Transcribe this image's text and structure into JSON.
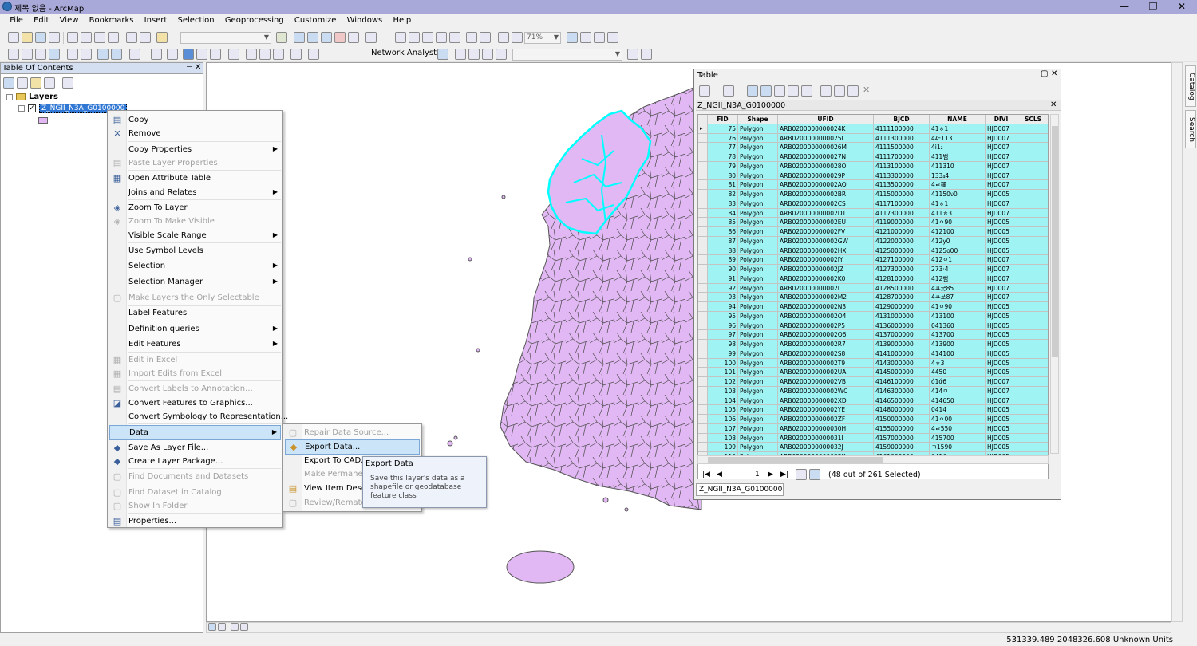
{
  "window": {
    "title": "제목 없음 - ArcMap",
    "minimize": "—",
    "maximize": "❐",
    "close": "✕"
  },
  "menubar": [
    "File",
    "Edit",
    "View",
    "Bookmarks",
    "Insert",
    "Selection",
    "Geoprocessing",
    "Customize",
    "Windows",
    "Help"
  ],
  "toolbar": {
    "zoom_level": "71%",
    "network_analyst": "Network Analyst ▾"
  },
  "toc": {
    "title": "Table Of Contents",
    "pin": "⊣",
    "close": "✕",
    "layers_label": "Layers",
    "layer_name": "Z_NGII_N3A_G0100000"
  },
  "context_menu": [
    {
      "label": "Copy",
      "icon": "copy-icon",
      "glyph": "▤",
      "disabled": false,
      "submenu": false
    },
    {
      "label": "Remove",
      "icon": "remove-icon",
      "glyph": "✕",
      "disabled": false,
      "submenu": false
    },
    {
      "label": "Copy Properties",
      "icon": "",
      "glyph": "",
      "disabled": false,
      "submenu": true
    },
    {
      "label": "Paste Layer Properties",
      "icon": "paste-icon",
      "glyph": "▤",
      "disabled": true,
      "submenu": false
    },
    {
      "label": "Open Attribute Table",
      "icon": "table-icon",
      "glyph": "▦",
      "disabled": false,
      "submenu": false
    },
    {
      "label": "Joins and Relates",
      "icon": "",
      "glyph": "",
      "disabled": false,
      "submenu": true
    },
    {
      "label": "Zoom To Layer",
      "icon": "zoom-to-layer-icon",
      "glyph": "◈",
      "disabled": false,
      "submenu": false
    },
    {
      "label": "Zoom To Make Visible",
      "icon": "zoom-visible-icon",
      "glyph": "◈",
      "disabled": true,
      "submenu": false
    },
    {
      "label": "Visible Scale Range",
      "icon": "",
      "glyph": "",
      "disabled": false,
      "submenu": true
    },
    {
      "label": "Use Symbol Levels",
      "icon": "",
      "glyph": "",
      "disabled": false,
      "submenu": false
    },
    {
      "label": "Selection",
      "icon": "",
      "glyph": "",
      "disabled": false,
      "submenu": true
    },
    {
      "label": "Selection Manager",
      "icon": "",
      "glyph": "",
      "disabled": false,
      "submenu": true
    },
    {
      "label": "Make Layers the Only Selectable",
      "icon": "selectable-icon",
      "glyph": "▢",
      "disabled": true,
      "submenu": false
    },
    {
      "label": "Label Features",
      "icon": "",
      "glyph": "",
      "disabled": false,
      "submenu": false
    },
    {
      "label": "Definition queries",
      "icon": "",
      "glyph": "",
      "disabled": false,
      "submenu": true
    },
    {
      "label": "Edit Features",
      "icon": "",
      "glyph": "",
      "disabled": false,
      "submenu": true
    },
    {
      "label": "Edit in Excel",
      "icon": "excel-icon",
      "glyph": "▦",
      "disabled": true,
      "submenu": false
    },
    {
      "label": "Import Edits from Excel",
      "icon": "import-excel-icon",
      "glyph": "▦",
      "disabled": true,
      "submenu": false
    },
    {
      "label": "Convert Labels to Annotation...",
      "icon": "annotation-icon",
      "glyph": "▤",
      "disabled": true,
      "submenu": false
    },
    {
      "label": "Convert Features to Graphics...",
      "icon": "graphics-icon",
      "glyph": "◪",
      "disabled": false,
      "submenu": false
    },
    {
      "label": "Convert Symbology to Representation...",
      "icon": "",
      "glyph": "",
      "disabled": false,
      "submenu": false
    },
    {
      "label": "Data",
      "icon": "",
      "glyph": "",
      "disabled": false,
      "submenu": true,
      "highlight": true
    },
    {
      "label": "Save As Layer File...",
      "icon": "layer-file-icon",
      "glyph": "◆",
      "disabled": false,
      "submenu": false
    },
    {
      "label": "Create Layer Package...",
      "icon": "layer-package-icon",
      "glyph": "◆",
      "disabled": false,
      "submenu": false
    },
    {
      "label": "Find Documents and Datasets",
      "icon": "find-docs-icon",
      "glyph": "▢",
      "disabled": true,
      "submenu": false
    },
    {
      "label": "Find Dataset in Catalog",
      "icon": "find-catalog-icon",
      "glyph": "▢",
      "disabled": true,
      "submenu": false
    },
    {
      "label": "Show In Folder",
      "icon": "folder-icon",
      "glyph": "▢",
      "disabled": true,
      "submenu": false
    },
    {
      "label": "Properties...",
      "icon": "properties-icon",
      "glyph": "▤",
      "disabled": false,
      "submenu": false
    }
  ],
  "data_submenu": [
    {
      "label": "Repair Data Source...",
      "icon": "repair-icon",
      "glyph": "▢",
      "disabled": true
    },
    {
      "label": "Export Data...",
      "icon": "export-icon",
      "glyph": "◆",
      "disabled": false,
      "highlight": true
    },
    {
      "label": "Export To CAD...",
      "icon": "",
      "glyph": "",
      "disabled": false
    },
    {
      "label": "Make Permanent",
      "icon": "",
      "glyph": "",
      "disabled": true
    },
    {
      "label": "View Item Descripti",
      "icon": "item-desc-icon",
      "glyph": "▤",
      "disabled": false
    },
    {
      "label": "Review/Rematch",
      "icon": "rematch-icon",
      "glyph": "▢",
      "disabled": true
    }
  ],
  "tooltip": {
    "title": "Export Data",
    "body": "Save this layer's data as a shapefile or geodatabase feature class"
  },
  "table": {
    "window_title": "Table",
    "layer_title": "Z_NGII_N3A_G0100000",
    "tab_label": "Z_NGII_N3A_G0100000",
    "page": "1",
    "selected_text": "(48 out of 261 Selected)",
    "columns": [
      "FID",
      "Shape",
      "UFID",
      "BJCD",
      "NAME",
      "DIVI",
      "SCLS"
    ],
    "rows": [
      [
        "75",
        "Polygon",
        "ARB0200000000024K",
        "4111100000",
        "41ㅎ1",
        "HJD007",
        ""
      ],
      [
        "76",
        "Polygon",
        "ARB0200000000025L",
        "4111300000",
        "4Æ113",
        "HJD007",
        ""
      ],
      [
        "77",
        "Polygon",
        "ARB0200000000026M",
        "4111500000",
        "4ì1₂",
        "HJD007",
        ""
      ],
      [
        "78",
        "Polygon",
        "ARB0200000000027N",
        "4111700000",
        "411뱀",
        "HJD007",
        ""
      ],
      [
        "79",
        "Polygon",
        "ARB0200000000028O",
        "4113100000",
        "411310",
        "HJD007",
        ""
      ],
      [
        "80",
        "Polygon",
        "ARB0200000000029P",
        "4113300000",
        "133₄4",
        "HJD007",
        ""
      ],
      [
        "81",
        "Polygon",
        "ARB020000000002AQ",
        "4113500000",
        "4ㄹ獼",
        "HJD007",
        ""
      ],
      [
        "82",
        "Polygon",
        "ARB020000000002BR",
        "4115000000",
        "41150ν0",
        "HJD005",
        ""
      ],
      [
        "83",
        "Polygon",
        "ARB020000000002CS",
        "4117100000",
        "41ㅎ1",
        "HJD007",
        ""
      ],
      [
        "84",
        "Polygon",
        "ARB020000000002DT",
        "4117300000",
        "411ㅎ3",
        "HJD007",
        ""
      ],
      [
        "85",
        "Polygon",
        "ARB020000000002EU",
        "4119000000",
        "41ㅇ90",
        "HJD005",
        ""
      ],
      [
        "86",
        "Polygon",
        "ARB020000000002FV",
        "4121000000",
        "412100",
        "HJD005",
        ""
      ],
      [
        "87",
        "Polygon",
        "ARB020000000002GW",
        "4122000000",
        "412у0",
        "HJD005",
        ""
      ],
      [
        "88",
        "Polygon",
        "ARB020000000002HX",
        "4125000000",
        "4125ο00",
        "HJD005",
        ""
      ],
      [
        "89",
        "Polygon",
        "ARB020000000002IY",
        "4127100000",
        "412ㅇ1",
        "HJD007",
        ""
      ],
      [
        "90",
        "Polygon",
        "ARB020000000002JZ",
        "4127300000",
        "273·4",
        "HJD007",
        ""
      ],
      [
        "91",
        "Polygon",
        "ARB020000000002K0",
        "4128100000",
        "412뼘",
        "HJD007",
        ""
      ],
      [
        "92",
        "Polygon",
        "ARB020000000002L1",
        "4128500000",
        "4ㅛ굿85",
        "HJD007",
        ""
      ],
      [
        "93",
        "Polygon",
        "ARB020000000002M2",
        "4128700000",
        "4ㅛ쏘87",
        "HJD007",
        ""
      ],
      [
        "94",
        "Polygon",
        "ARB020000000002N3",
        "4129000000",
        "41ㅇ90",
        "HJD005",
        ""
      ],
      [
        "95",
        "Polygon",
        "ARB020000000002O4",
        "4131000000",
        "413100",
        "HJD005",
        ""
      ],
      [
        "96",
        "Polygon",
        "ARB020000000002P5",
        "4136000000",
        "041360",
        "HJD005",
        ""
      ],
      [
        "97",
        "Polygon",
        "ARB020000000002Q6",
        "4137000000",
        "413700",
        "HJD005",
        ""
      ],
      [
        "98",
        "Polygon",
        "ARB020000000002R7",
        "4139000000",
        "413900",
        "HJD005",
        ""
      ],
      [
        "99",
        "Polygon",
        "ARB020000000002S8",
        "4141000000",
        "414100",
        "HJD005",
        ""
      ],
      [
        "100",
        "Polygon",
        "ARB020000000002T9",
        "4143000000",
        "4ㅎ3",
        "HJD005",
        ""
      ],
      [
        "101",
        "Polygon",
        "ARB020000000002UA",
        "4145000000",
        "4450",
        "HJD005",
        ""
      ],
      [
        "102",
        "Polygon",
        "ARB020000000002VB",
        "4146100000",
        "ό1ά6",
        "HJD007",
        ""
      ],
      [
        "103",
        "Polygon",
        "ARB020000000002WC",
        "4146300000",
        "414ㅁ",
        "HJD007",
        ""
      ],
      [
        "104",
        "Polygon",
        "ARB020000000002XD",
        "4146500000",
        "414650",
        "HJD007",
        ""
      ],
      [
        "105",
        "Polygon",
        "ARB020000000002YE",
        "4148000000",
        "0414",
        "HJD005",
        ""
      ],
      [
        "106",
        "Polygon",
        "ARB020000000002ZF",
        "4150000000",
        "41ㅇ00",
        "HJD005",
        ""
      ],
      [
        "107",
        "Polygon",
        "ARB0200000000030H",
        "4155000000",
        "4ㄹ550",
        "HJD005",
        ""
      ],
      [
        "108",
        "Polygon",
        "ARB0200000000031I",
        "4157000000",
        "415700",
        "HJD005",
        ""
      ],
      [
        "109",
        "Polygon",
        "ARB0200000000032J",
        "4159000000",
        "ㅋ1590",
        "HJD005",
        ""
      ],
      [
        "110",
        "Polygon",
        "ARB0200000000033K",
        "4161000000",
        "0416",
        "HJD005",
        ""
      ]
    ]
  },
  "statusbar": {
    "coords": "531339.489  2048326.608 Unknown Units"
  },
  "dock": {
    "catalog": "Catalog",
    "search": "Search"
  },
  "colors": {
    "selection": "#00ffff",
    "polygon_fill": "#e1b8f3",
    "highlight": "#cce4f7",
    "selected_row": "#9ff3f3"
  }
}
